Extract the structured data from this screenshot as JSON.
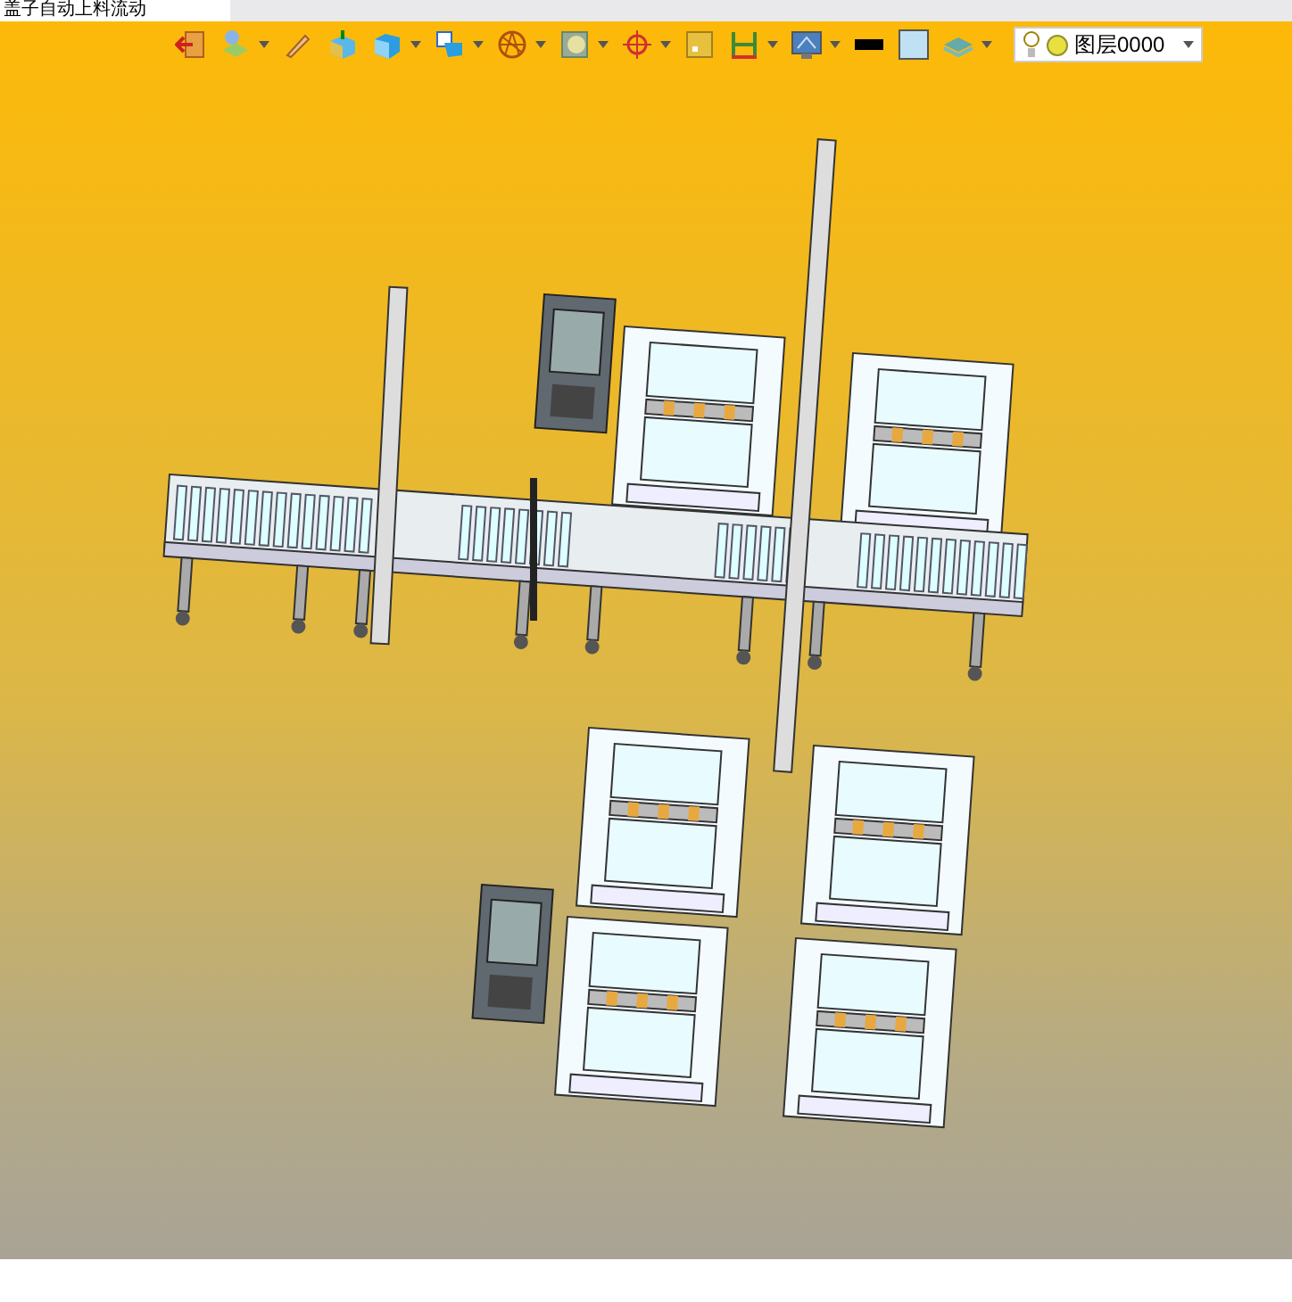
{
  "document_tab": {
    "title": "盖子自动上料流动"
  },
  "toolbar": {
    "layer_select": {
      "value": "图层0000"
    }
  }
}
